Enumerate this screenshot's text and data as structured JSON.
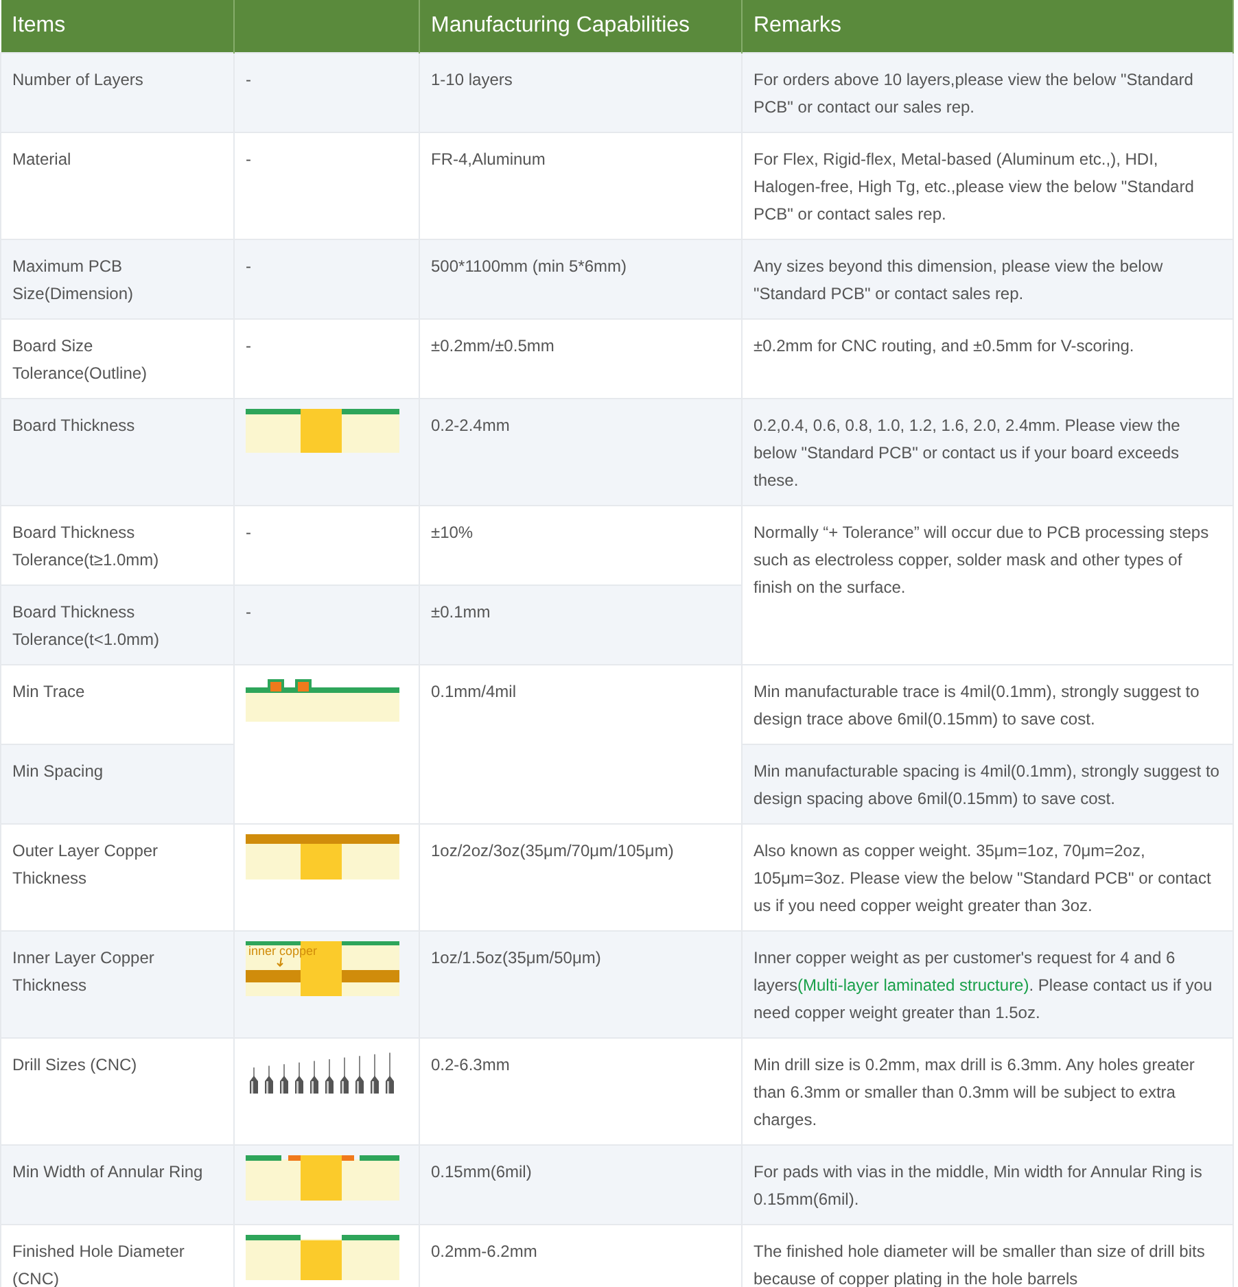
{
  "table": {
    "columns": [
      "Items",
      "",
      "Manufacturing Capabilities",
      "Remarks"
    ],
    "rows": [
      {
        "item": "Number of Layers",
        "figure": {
          "kind": "text",
          "text": "-"
        },
        "capability": "1-10 layers",
        "remark": "For orders above 10 layers,please view the below \"Standard PCB\" or contact our sales rep."
      },
      {
        "item": "Material",
        "figure": {
          "kind": "text",
          "text": "-"
        },
        "capability": "FR-4,Aluminum",
        "remark": "For Flex, Rigid-flex, Metal-based (Aluminum etc.,), HDI, Halogen-free, High Tg, etc.,please view the below \"Standard PCB\" or contact sales rep."
      },
      {
        "item": "Maximum PCB Size(Dimension)",
        "figure": {
          "kind": "text",
          "text": "-"
        },
        "capability": "500*1100mm (min 5*6mm)",
        "remark": "Any sizes beyond this dimension, please view the below \"Standard PCB\" or contact sales rep."
      },
      {
        "item": "Board Size Tolerance(Outline)",
        "figure": {
          "kind": "text",
          "text": "-"
        },
        "capability": "±0.2mm/±0.5mm",
        "remark": "±0.2mm for CNC routing, and ±0.5mm for V-scoring."
      },
      {
        "item": "Board Thickness",
        "figure": {
          "kind": "thickness"
        },
        "capability": "0.2-2.4mm",
        "remark": "0.2,0.4, 0.6, 0.8, 1.0, 1.2, 1.6, 2.0, 2.4mm. Please view the below \"Standard PCB\" or contact us if your board exceeds these."
      },
      {
        "item": "Board Thickness Tolerance(t≥1.0mm)",
        "figure": {
          "kind": "text",
          "text": "-"
        },
        "capability": "±10%",
        "remark": "Normally “+ Tolerance” will occur due to PCB processing steps such as electroless copper, solder mask and other types of finish on the surface."
      },
      {
        "item": "Board Thickness Tolerance(t<1.0mm)",
        "figure": {
          "kind": "text",
          "text": "-"
        },
        "capability": "±0.1mm"
      },
      {
        "item": "Min Trace",
        "figure": {
          "kind": "trace"
        },
        "capability": "0.1mm/4mil",
        "remark": "Min manufacturable trace is 4mil(0.1mm), strongly suggest to design trace above 6mil(0.15mm) to save cost."
      },
      {
        "item": "Min Spacing",
        "remark": "Min manufacturable spacing is 4mil(0.1mm), strongly suggest to design spacing above 6mil(0.15mm) to save cost."
      },
      {
        "item": "Outer Layer Copper Thickness",
        "figure": {
          "kind": "outer_copper"
        },
        "capability": "1oz/2oz/3oz(35μm/70μm/105μm)",
        "remark": "Also known as copper weight. 35μm=1oz, 70μm=2oz, 105μm=3oz. Please view the below \"Standard PCB\" or contact us if you need copper weight greater than 3oz."
      },
      {
        "item": "Inner Layer Copper Thickness",
        "figure": {
          "kind": "inner_copper",
          "label": "inner copper"
        },
        "capability": "1oz/1.5oz(35μm/50μm)",
        "remark": [
          {
            "kind": "text",
            "text": "Inner copper weight as per customer's request for 4 and 6 layers"
          },
          {
            "kind": "link",
            "text": "(Multi-layer laminated structure)"
          },
          {
            "kind": "text",
            "text": ". Please contact us if you need copper weight greater than 1.5oz."
          }
        ]
      },
      {
        "item": "Drill Sizes (CNC)",
        "figure": {
          "kind": "drill"
        },
        "capability": "0.2-6.3mm",
        "remark": "Min drill size is 0.2mm, max drill is 6.3mm. Any holes greater than 6.3mm or smaller than 0.3mm will be subject to extra charges."
      },
      {
        "item": "Min Width of Annular Ring",
        "figure": {
          "kind": "annular"
        },
        "capability": "0.15mm(6mil)",
        "remark": "For pads with vias in the middle, Min width for Annular Ring is 0.15mm(6mil)."
      },
      {
        "item": "Finished Hole Diameter (CNC)",
        "figure": {
          "kind": "hole"
        },
        "capability": "0.2mm-6.2mm",
        "remark": "The finished hole diameter will be smaller than size of drill bits because of copper plating in the hole barrels"
      }
    ]
  }
}
